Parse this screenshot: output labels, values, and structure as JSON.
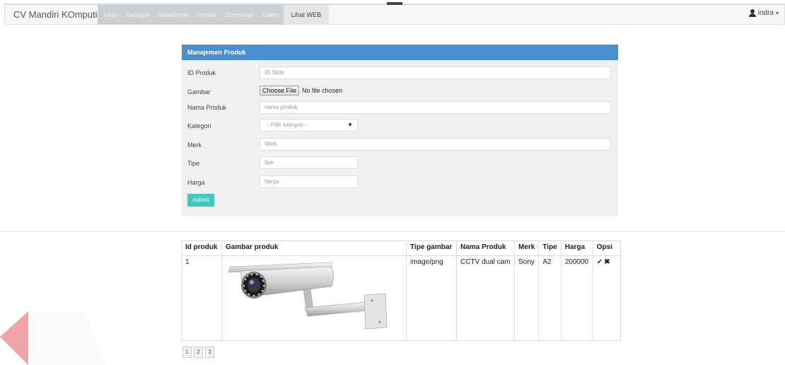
{
  "navbar": {
    "brand": "CV Mandiri KOmputindo",
    "items": [
      {
        "label": "User"
      },
      {
        "label": "Kategori"
      },
      {
        "label": "SlideShow"
      },
      {
        "label": "Produk"
      },
      {
        "label": "Download"
      },
      {
        "label": "Galeri"
      },
      {
        "label": "Lihat WEB"
      }
    ],
    "user": "indra",
    "user_caret": "▾",
    "user_icon": "user-icon"
  },
  "form": {
    "title": "Manajemen Produk",
    "fields": {
      "id": {
        "label": "ID Produk",
        "placeholder": "ID Slide"
      },
      "gambar": {
        "label": "Gambar",
        "button": "Choose File",
        "status": "No file chosen"
      },
      "nama": {
        "label": "Nama Produk",
        "placeholder": "nama produk"
      },
      "kategori": {
        "label": "Kategori",
        "selected": "- Pilih kategori -"
      },
      "merk": {
        "label": "Merk",
        "placeholder": "Merk"
      },
      "tipe": {
        "label": "Tipe",
        "placeholder": "tipe"
      },
      "harga": {
        "label": "Harga",
        "placeholder": "harga"
      }
    },
    "submit": "submit",
    "colors": {
      "header": "#4a90d0",
      "submit": "#3fc7c0",
      "panel": "#f1f1f1"
    }
  },
  "table": {
    "headers": [
      "Id produk",
      "Gambar produk",
      "Tipe gambar",
      "Nama Produk",
      "Merk",
      "Tipe",
      "Harga",
      "Opsi"
    ],
    "rows": [
      {
        "id": "1",
        "image_alt": "CCTV camera",
        "tipe_gambar": "image/png",
        "nama": "CCTV dual cam",
        "merk": "Sony",
        "tipe": "A2",
        "harga": "200000",
        "opsi": [
          "edit-icon",
          "delete-icon"
        ]
      }
    ]
  },
  "pagination": {
    "pages": [
      "1",
      "2",
      "3"
    ]
  }
}
